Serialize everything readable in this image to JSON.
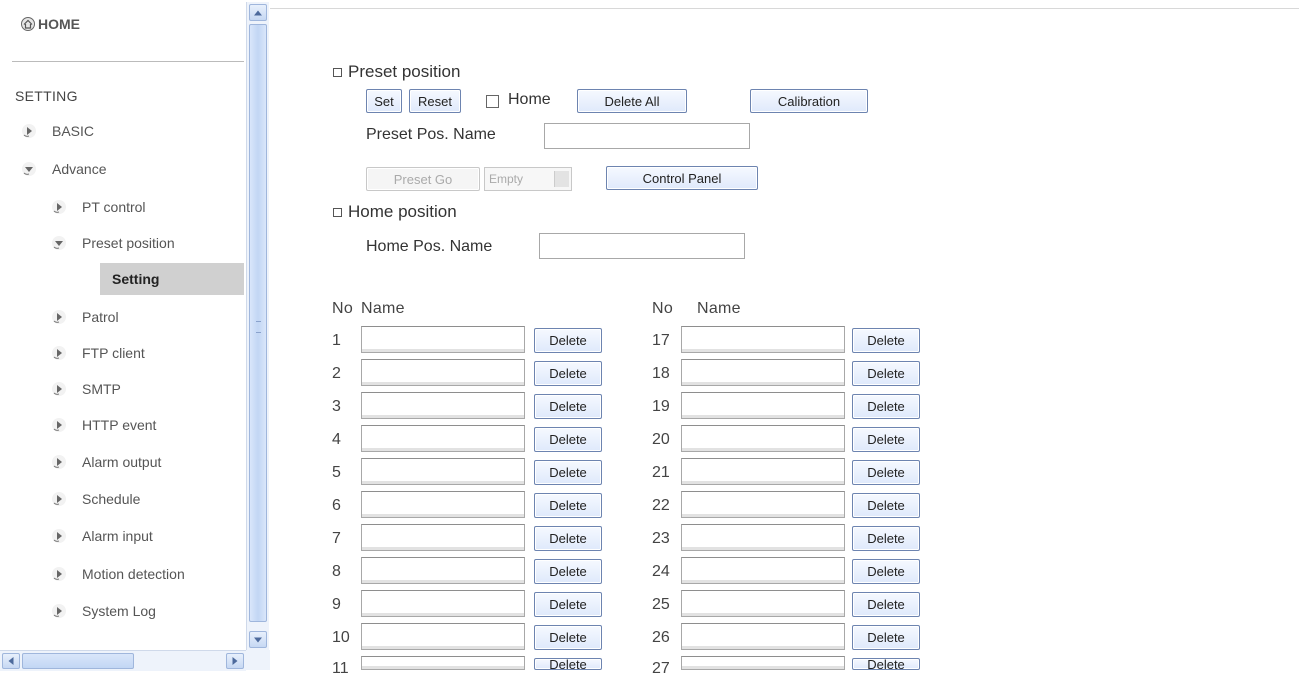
{
  "nav": {
    "home": "HOME",
    "setting": "SETTING",
    "basic": "BASIC",
    "advance": "Advance",
    "items": [
      {
        "label": "PT control"
      },
      {
        "label": "Preset position"
      },
      {
        "label": "Patrol"
      },
      {
        "label": "FTP client"
      },
      {
        "label": "SMTP"
      },
      {
        "label": "HTTP event"
      },
      {
        "label": "Alarm output"
      },
      {
        "label": "Schedule"
      },
      {
        "label": "Alarm input"
      },
      {
        "label": "Motion detection"
      },
      {
        "label": "System Log"
      }
    ],
    "selected_sub": "Setting"
  },
  "preset": {
    "title": "Preset position",
    "set_btn": "Set",
    "reset_btn": "Reset",
    "home_label": "Home",
    "delete_all_btn": "Delete All",
    "calibration_btn": "Calibration",
    "name_label": "Preset Pos. Name",
    "name_value": "",
    "go_btn": "Preset Go",
    "select_value": "Empty",
    "control_panel_btn": "Control Panel"
  },
  "home_position": {
    "title": "Home position",
    "name_label": "Home Pos. Name",
    "name_value": ""
  },
  "table": {
    "no_header": "No",
    "name_header": "Name",
    "delete_label": "Delete",
    "left_rows": [
      "1",
      "2",
      "3",
      "4",
      "5",
      "6",
      "7",
      "8",
      "9",
      "10",
      "11"
    ],
    "right_rows": [
      "17",
      "18",
      "19",
      "20",
      "21",
      "22",
      "23",
      "24",
      "25",
      "26",
      "27"
    ]
  },
  "colors": {
    "accent_button_border": "#6d84b0",
    "selected_nav_bg": "#d0d0d0",
    "scrollbar": "#c2d6f4"
  },
  "icons": {
    "home": "home-icon",
    "collapsed": "arrow-right-icon",
    "expanded": "arrow-down-icon"
  }
}
